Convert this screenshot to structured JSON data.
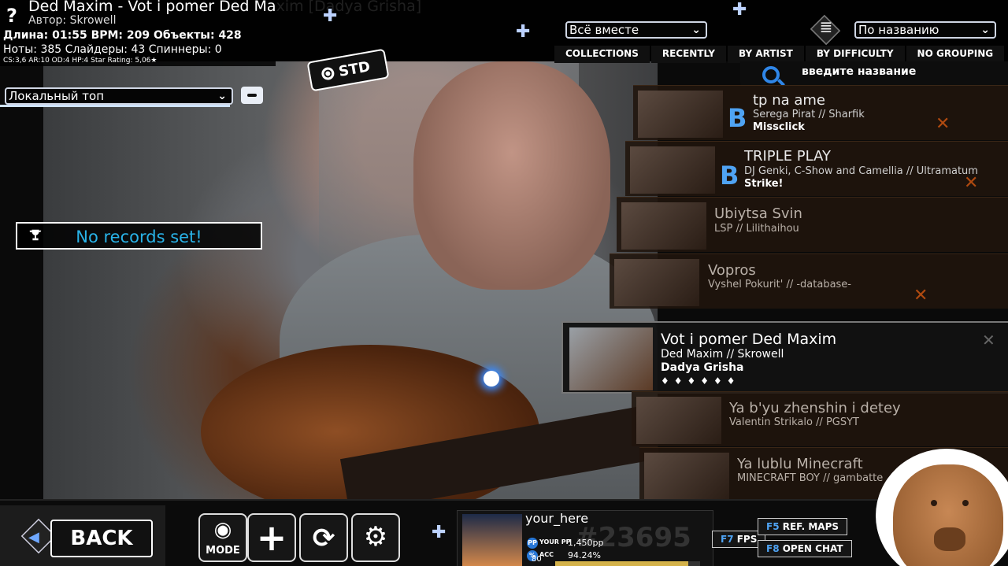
{
  "beatmap": {
    "title": "Ded Maxim - Vot i pomer Ded Maxim [Dadya Grisha]",
    "author": "Автор: Skrowell",
    "stats_line1": "Длина: 01:55 BPM: 209 Объекты: 428",
    "stats_line2": "Ноты: 385 Слайдеры: 43 Спиннеры: 0",
    "stats_line3": "CS:3,6 AR:10 OD:4 HP:4 Star Rating: 5,06★"
  },
  "mode_badge": "STD",
  "leaderboard": {
    "dropdown_value": "Локальный топ",
    "records_message": "No records set!"
  },
  "filters": {
    "group_dropdown": "Всё вместе",
    "sort_dropdown": "По названию"
  },
  "tabs": [
    "COLLECTIONS",
    "RECENTLY",
    "BY ARTIST",
    "BY DIFFICULTY",
    "NO GROUPING"
  ],
  "search": {
    "placeholder": "введите название"
  },
  "songs": [
    {
      "title": "tp na ame",
      "artist": "Serega Pirat // Sharfik",
      "diff": "Missclick",
      "grade": "B"
    },
    {
      "title": "TRIPLE PLAY",
      "artist": "DJ Genki, C-Show and Camellia // Ultramatum",
      "diff": "Strike!",
      "grade": "B"
    },
    {
      "title": "Ubiytsa Svin",
      "artist": "LSP // Lilithaihou"
    },
    {
      "title": "Vopros",
      "artist": "Vyshel Pokurit' // -database-"
    },
    {
      "title": "Ya b'yu zhenshin i detey",
      "artist": "Valentin Strikalo // PGSYT"
    },
    {
      "title": "Ya lublu Minecraft",
      "artist": "MINECRAFT BOY // gambatte"
    }
  ],
  "selected_song": {
    "title": "Vot i pomer Ded Maxim",
    "artist": "Ded Maxim // Skrowell",
    "diff": "Dadya Grisha",
    "stars": "♦♦♦♦♦♦"
  },
  "bottom": {
    "back_label": "BACK",
    "mode_label": "MODE",
    "username": "your_here",
    "pp_label": "YOUR PP",
    "pp_value": "1,450pp",
    "acc_label": "ACC",
    "acc_value": "94.24%",
    "level": "80",
    "level_progress": 0.92,
    "rank": "#23695",
    "f7": "F7",
    "f7_label": "FPS",
    "f5": "F5",
    "f5_label": "REF. MAPS",
    "f8": "F8",
    "f8_label": "OPEN CHAT"
  }
}
